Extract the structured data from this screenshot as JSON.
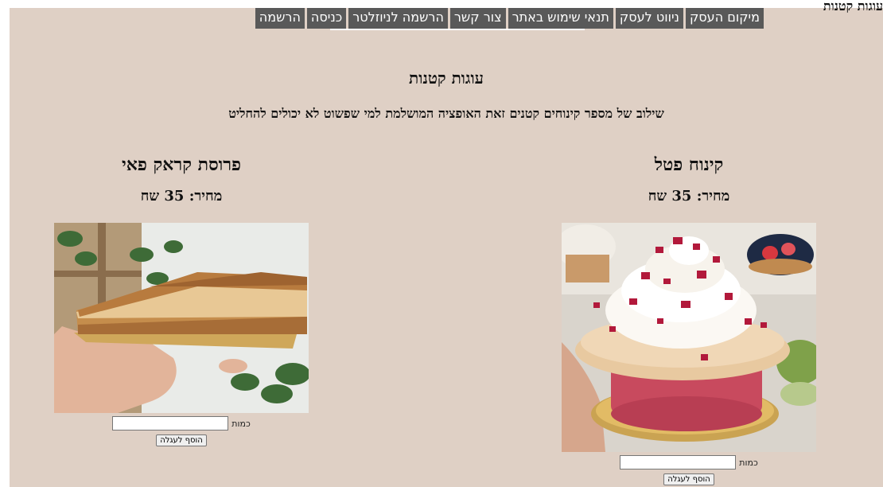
{
  "header": {
    "corner_title": "עוגות קטנות"
  },
  "nav": {
    "items": [
      {
        "label": "מיקום העסק"
      },
      {
        "label": "ניווט לעסק"
      },
      {
        "label": "תנאי שימוש באתר"
      },
      {
        "label": "צור קשר"
      },
      {
        "label": "הרשמה לניוזלטר"
      },
      {
        "label": "כניסה"
      },
      {
        "label": "הרשמה"
      }
    ]
  },
  "category": {
    "title": "עוגות קטנות",
    "description": "שילוב של מספר קינוחים קטנים זאת האופציה המושלמת למי שפשוט לא יכולים להחליט"
  },
  "products": [
    {
      "name": "קינוח פטל",
      "price": "מחיר: 35 שח",
      "quantity_label": "כמות",
      "quantity_value": "",
      "add_button": "הוסף לעגלה"
    },
    {
      "name": "פרוסת קראק פאי",
      "price": "מחיר: 35 שח",
      "quantity_label": "כמות",
      "quantity_value": "",
      "add_button": "הוסף לעגלה"
    }
  ],
  "colors": {
    "page_background": "#dfd0c5",
    "nav_background": "#595959",
    "nav_text": "#ffffff"
  }
}
